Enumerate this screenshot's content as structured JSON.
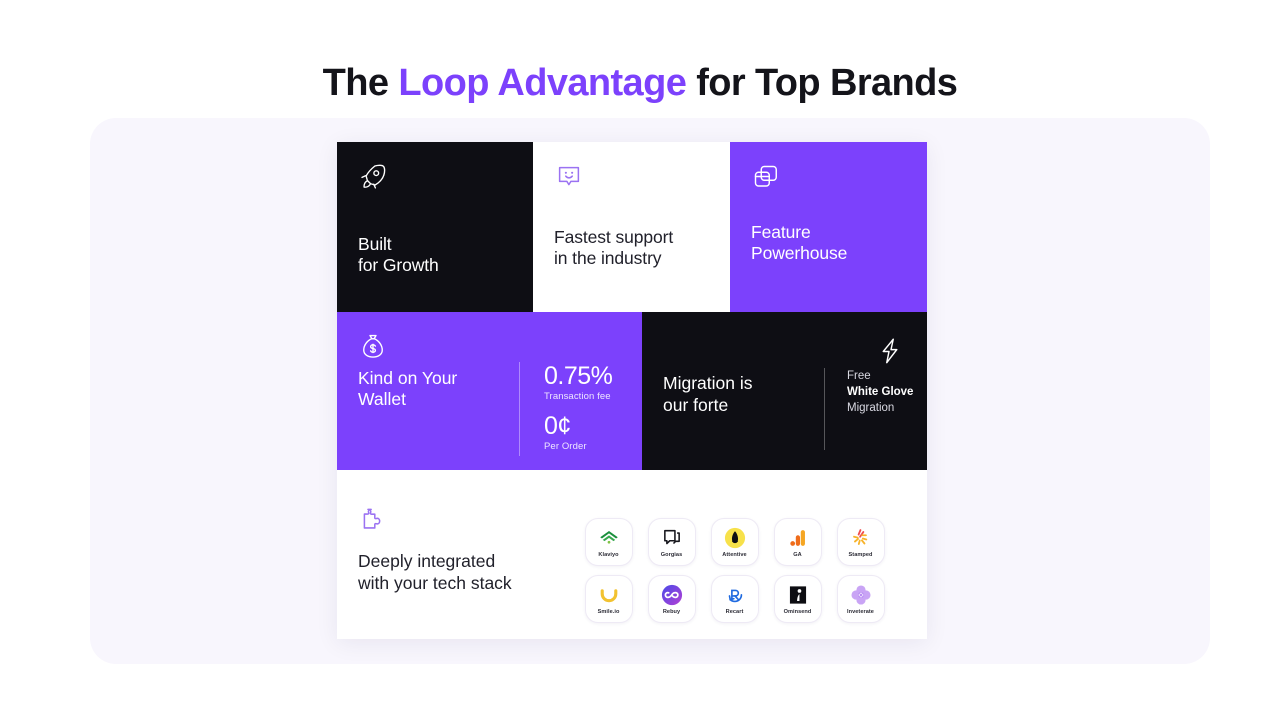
{
  "heading": {
    "before": "The ",
    "accent": "Loop Advantage",
    "after": " for Top Brands"
  },
  "colors": {
    "accent_purple": "#7c41fc",
    "dark": "#0e0e14",
    "panel_bg": "#f8f6fd",
    "white": "#ffffff"
  },
  "cards": {
    "built": {
      "title": "Built\nfor Growth",
      "icon": "rocket-icon"
    },
    "support": {
      "title": "Fastest support\nin the industry",
      "icon": "chat-smiley-icon"
    },
    "feature": {
      "title": "Feature\nPowerhouse",
      "icon": "stacked-windows-icon"
    },
    "wallet": {
      "title": "Kind on Your\nWallet",
      "icon": "money-bag-icon",
      "stats": [
        {
          "value": "0.75%",
          "label": "Transaction fee"
        },
        {
          "value": "0¢",
          "label": "Per Order"
        }
      ]
    },
    "migration": {
      "title": "Migration is\nour forte",
      "icon": "lightning-bolt-icon",
      "note": {
        "line1": "Free",
        "line2": "White Glove",
        "line3": "Migration"
      }
    },
    "integrations": {
      "title": "Deeply integrated\nwith your tech stack",
      "icon": "puzzle-piece-icon",
      "logos": [
        {
          "name": "Klaviyo",
          "icon": "klaviyo-logo"
        },
        {
          "name": "Gorgias",
          "icon": "gorgias-logo"
        },
        {
          "name": "Attentive",
          "icon": "attentive-logo"
        },
        {
          "name": "GA",
          "icon": "ga-logo"
        },
        {
          "name": "Stamped",
          "icon": "stamped-logo"
        },
        {
          "name": "Smile.io",
          "icon": "smileio-logo"
        },
        {
          "name": "Rebuy",
          "icon": "rebuy-logo"
        },
        {
          "name": "Recart",
          "icon": "recart-logo"
        },
        {
          "name": "Ominsend",
          "icon": "ominsend-logo"
        },
        {
          "name": "Inveterate",
          "icon": "inveterate-logo"
        }
      ]
    }
  }
}
